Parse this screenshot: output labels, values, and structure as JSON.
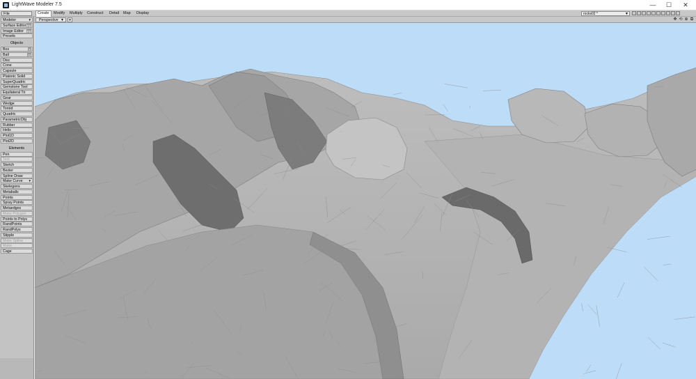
{
  "window": {
    "title": "LightWave Modeler 7.5",
    "minimize": "—",
    "maximize": "☐",
    "close": "✕"
  },
  "menu": {
    "file": "File",
    "tabs": [
      "Create",
      "Modify",
      "Multiply",
      "Construct",
      "Detail",
      "Map",
      "Display"
    ],
    "active_tab": "Create",
    "layer_select": "rocks02 *"
  },
  "sidebar": {
    "top": [
      {
        "label": "Modeler",
        "arrow": "▾"
      },
      {
        "label": "Surface Editor",
        "badge": "F5"
      },
      {
        "label": "Image Editor",
        "badge": "F6"
      },
      {
        "label": "Presets"
      }
    ],
    "objects_header": "Objects",
    "objects": [
      {
        "label": "Box",
        "badge": "X"
      },
      {
        "label": "Ball",
        "badge": "O"
      },
      {
        "label": "Disc"
      },
      {
        "label": "Cone"
      },
      {
        "label": "Capsule"
      },
      {
        "label": "Platonic Solid"
      },
      {
        "label": "SuperQuadric"
      },
      {
        "label": "Gemstone Tool"
      },
      {
        "label": "Equilateral Tri"
      },
      {
        "label": "Gear"
      },
      {
        "label": "Wedge"
      },
      {
        "label": "Toroid"
      },
      {
        "label": "Quadric"
      },
      {
        "label": "ParametricObj"
      },
      {
        "label": "Rubber"
      },
      {
        "label": "Helix"
      },
      {
        "label": "Plot1D"
      },
      {
        "label": "Plot2D"
      }
    ],
    "elements_header": "Elements",
    "elements": [
      {
        "label": "Pen"
      },
      {
        "label": "Text",
        "dim": true
      },
      {
        "label": "Sketch"
      },
      {
        "label": "Bezier"
      },
      {
        "label": "Spline Draw"
      },
      {
        "label": "Make Curve",
        "arrow": "▾"
      },
      {
        "label": "Skelegons"
      },
      {
        "label": "Metaballs"
      },
      {
        "label": "Points"
      },
      {
        "label": "Spray Points"
      },
      {
        "label": "Metaedges"
      },
      {
        "label": "Make Polygon",
        "dim": true
      },
      {
        "label": "Points to Polys"
      },
      {
        "label": "RandPoints"
      },
      {
        "label": "RandPolys"
      },
      {
        "label": "Stipple"
      },
      {
        "label": "Make Spline",
        "dim": true
      },
      {
        "label": "Make",
        "dim": true
      },
      {
        "label": "Cage"
      }
    ]
  },
  "viewport": {
    "mode": "Perspective",
    "options_arrow": "▾",
    "icons": [
      "✥",
      "⟲",
      "⊕",
      "⧉"
    ],
    "background_color": "#bcdcf7"
  }
}
